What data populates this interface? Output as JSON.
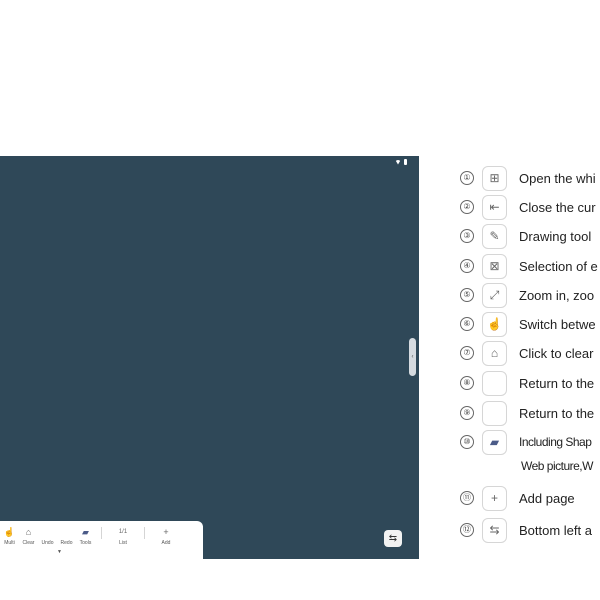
{
  "board": {
    "toolbar": {
      "items": [
        {
          "label": "Multi",
          "icon": "multi-touch-icon"
        },
        {
          "label": "Clear",
          "icon": "clear-icon"
        },
        {
          "label": "Undo",
          "icon": "undo-icon"
        },
        {
          "label": "Redo",
          "icon": "redo-icon"
        },
        {
          "label": "Tools",
          "icon": "toolbox-icon"
        }
      ],
      "list_page": "1/1",
      "list_label": "List",
      "add_label": "Add"
    }
  },
  "legend": {
    "items": [
      {
        "num": "①",
        "icon": "grid-apps-icon",
        "text": "Open the whi"
      },
      {
        "num": "②",
        "icon": "exit-icon",
        "text": "Close the cur"
      },
      {
        "num": "③",
        "icon": "pen-icon",
        "text": "Drawing  tool"
      },
      {
        "num": "④",
        "icon": "select-icon",
        "text": "Selection of e"
      },
      {
        "num": "⑤",
        "icon": "zoom-gesture-icon",
        "text": "Zoom in, zoo"
      },
      {
        "num": "⑥",
        "icon": "multi-touch-icon",
        "text": "Switch betwe"
      },
      {
        "num": "⑦",
        "icon": "clear-icon",
        "text": "Click to clear"
      },
      {
        "num": "⑧",
        "icon": "undo-icon",
        "text": "Return to the"
      },
      {
        "num": "⑨",
        "icon": "redo-icon",
        "text": "Return to the"
      },
      {
        "num": "⑩",
        "icon": "toolbox-icon",
        "text": "Including Shap"
      },
      {
        "num": "⑪",
        "icon": "plus-icon",
        "text": "Add page"
      },
      {
        "num": "⑫",
        "icon": "swap-icon",
        "text": "Bottom left a"
      }
    ],
    "continuation": "Web picture,W"
  }
}
